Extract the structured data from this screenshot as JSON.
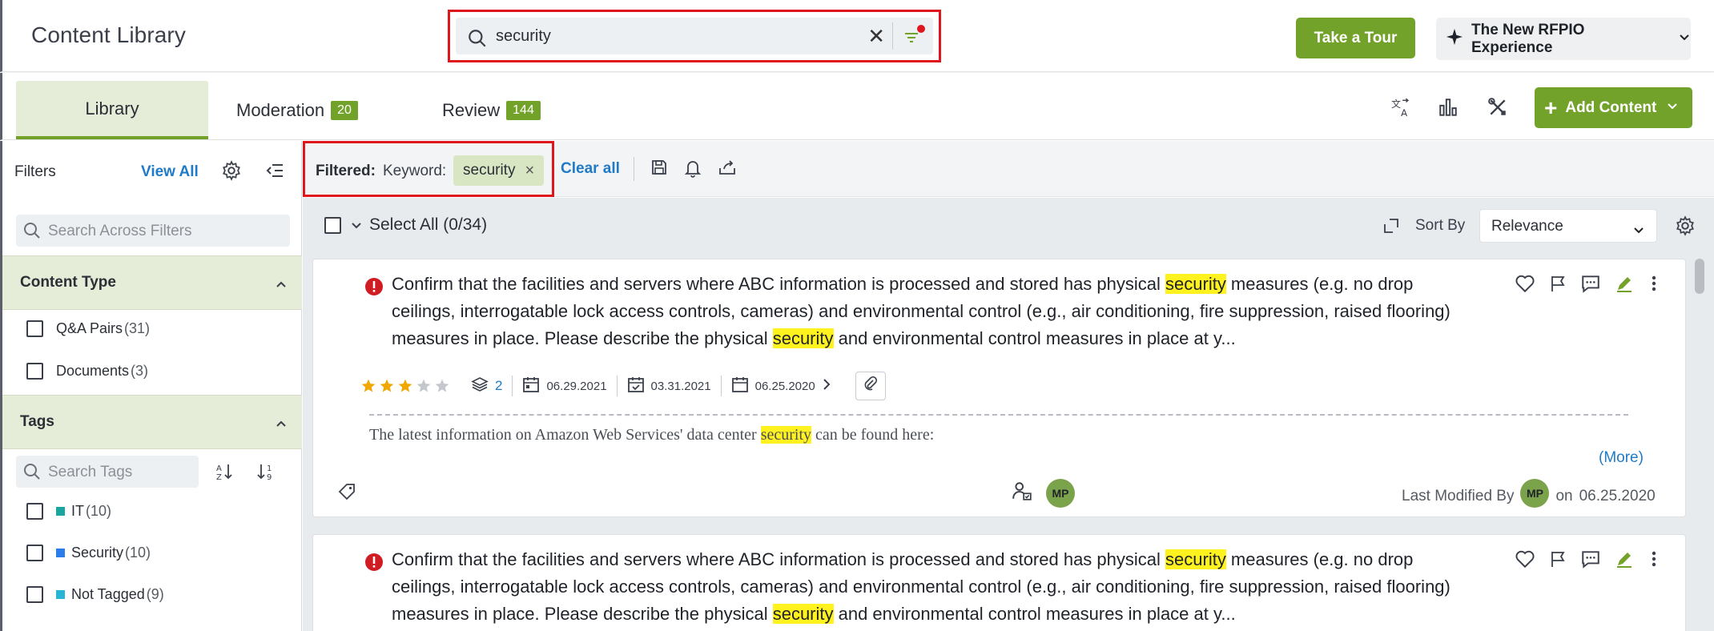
{
  "header": {
    "title": "Content Library",
    "search": {
      "value": "security",
      "clear": "✕"
    },
    "tour_label": "Take a Tour",
    "experience_label": "The New RFPIO Experience"
  },
  "tabs": [
    {
      "label": "Library"
    },
    {
      "label": "Moderation",
      "badge": "20"
    },
    {
      "label": "Review",
      "badge": "144"
    }
  ],
  "toolbar": {
    "add_label": "Add Content"
  },
  "sidebar": {
    "title": "Filters",
    "view_all": "View All",
    "search_placeholder": "Search Across Filters",
    "content_type": {
      "label": "Content Type",
      "items": [
        {
          "label": "Q&A Pairs",
          "count": "(31)"
        },
        {
          "label": "Documents",
          "count": "(3)"
        }
      ]
    },
    "tags": {
      "label": "Tags",
      "search_placeholder": "Search Tags",
      "items": [
        {
          "label": "IT",
          "count": "(10)",
          "color": "#1aa5a0"
        },
        {
          "label": "Security",
          "count": "(10)",
          "color": "#2b7de9"
        },
        {
          "label": "Not Tagged",
          "count": "(9)",
          "color": "#28b4d6"
        }
      ]
    }
  },
  "filterbar": {
    "filtered_label": "Filtered:",
    "keyword_label": "Keyword:",
    "chip": "security",
    "chip_remove": "×",
    "clear_all": "Clear all"
  },
  "list": {
    "select_all": "Select All (0/34)",
    "sort_by_label": "Sort By",
    "sort_value": "Relevance"
  },
  "cards": [
    {
      "q_part1": "Confirm that the facilities and servers where ABC information is processed and stored has physical ",
      "q_hl1": "security",
      "q_part2": " measures (e.g. no drop ceilings, interrogatable lock access controls, cameras) and environmental control (e.g., air conditioning, fire suppression, raised flooring) measures in place. Please describe the physical ",
      "q_hl2": "security",
      "q_part3": " and environmental control measures in place at y...",
      "rating": 3,
      "versions": "2",
      "date1": "06.29.2021",
      "date2": "03.31.2021",
      "date3": "06.25.2020",
      "answer_part1": "The latest information on Amazon Web Services' data center ",
      "answer_hl": "security",
      "answer_part2": " can be found here:",
      "more": "(More)",
      "owner_initials": "MP",
      "last_modified_label": "Last Modified By",
      "modifier_initials": "MP",
      "on_label": "on",
      "modified_date": "06.25.2020"
    },
    {
      "q_part1": "Confirm that the facilities and servers where ABC information is processed and stored has physical ",
      "q_hl1": "security",
      "q_part2": " measures (e.g. no drop ceilings, interrogatable lock access controls, cameras) and environmental control (e.g., air conditioning, fire suppression, raised flooring) measures in place. Please describe the physical ",
      "q_hl2": "security",
      "q_part3": " and environmental control measures in place at y..."
    }
  ],
  "colors": {
    "accent": "#73a22a",
    "link": "#1f7ac7",
    "highlight": "#fff21f",
    "alert": "#e0161f",
    "star": "#f0a800"
  }
}
